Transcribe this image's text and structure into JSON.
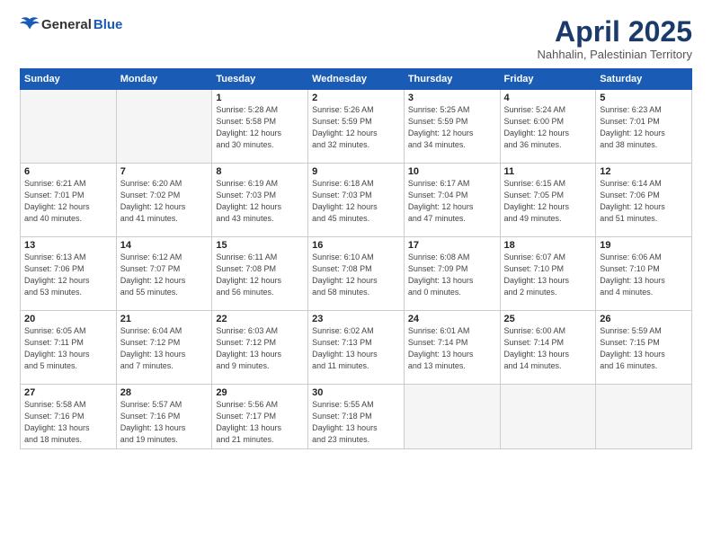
{
  "logo": {
    "general": "General",
    "blue": "Blue"
  },
  "header": {
    "month": "April 2025",
    "location": "Nahhalin, Palestinian Territory"
  },
  "weekdays": [
    "Sunday",
    "Monday",
    "Tuesday",
    "Wednesday",
    "Thursday",
    "Friday",
    "Saturday"
  ],
  "weeks": [
    [
      {
        "day": "",
        "info": ""
      },
      {
        "day": "",
        "info": ""
      },
      {
        "day": "1",
        "info": "Sunrise: 5:28 AM\nSunset: 5:58 PM\nDaylight: 12 hours\nand 30 minutes."
      },
      {
        "day": "2",
        "info": "Sunrise: 5:26 AM\nSunset: 5:59 PM\nDaylight: 12 hours\nand 32 minutes."
      },
      {
        "day": "3",
        "info": "Sunrise: 5:25 AM\nSunset: 5:59 PM\nDaylight: 12 hours\nand 34 minutes."
      },
      {
        "day": "4",
        "info": "Sunrise: 5:24 AM\nSunset: 6:00 PM\nDaylight: 12 hours\nand 36 minutes."
      },
      {
        "day": "5",
        "info": "Sunrise: 6:23 AM\nSunset: 7:01 PM\nDaylight: 12 hours\nand 38 minutes."
      }
    ],
    [
      {
        "day": "6",
        "info": "Sunrise: 6:21 AM\nSunset: 7:01 PM\nDaylight: 12 hours\nand 40 minutes."
      },
      {
        "day": "7",
        "info": "Sunrise: 6:20 AM\nSunset: 7:02 PM\nDaylight: 12 hours\nand 41 minutes."
      },
      {
        "day": "8",
        "info": "Sunrise: 6:19 AM\nSunset: 7:03 PM\nDaylight: 12 hours\nand 43 minutes."
      },
      {
        "day": "9",
        "info": "Sunrise: 6:18 AM\nSunset: 7:03 PM\nDaylight: 12 hours\nand 45 minutes."
      },
      {
        "day": "10",
        "info": "Sunrise: 6:17 AM\nSunset: 7:04 PM\nDaylight: 12 hours\nand 47 minutes."
      },
      {
        "day": "11",
        "info": "Sunrise: 6:15 AM\nSunset: 7:05 PM\nDaylight: 12 hours\nand 49 minutes."
      },
      {
        "day": "12",
        "info": "Sunrise: 6:14 AM\nSunset: 7:06 PM\nDaylight: 12 hours\nand 51 minutes."
      }
    ],
    [
      {
        "day": "13",
        "info": "Sunrise: 6:13 AM\nSunset: 7:06 PM\nDaylight: 12 hours\nand 53 minutes."
      },
      {
        "day": "14",
        "info": "Sunrise: 6:12 AM\nSunset: 7:07 PM\nDaylight: 12 hours\nand 55 minutes."
      },
      {
        "day": "15",
        "info": "Sunrise: 6:11 AM\nSunset: 7:08 PM\nDaylight: 12 hours\nand 56 minutes."
      },
      {
        "day": "16",
        "info": "Sunrise: 6:10 AM\nSunset: 7:08 PM\nDaylight: 12 hours\nand 58 minutes."
      },
      {
        "day": "17",
        "info": "Sunrise: 6:08 AM\nSunset: 7:09 PM\nDaylight: 13 hours\nand 0 minutes."
      },
      {
        "day": "18",
        "info": "Sunrise: 6:07 AM\nSunset: 7:10 PM\nDaylight: 13 hours\nand 2 minutes."
      },
      {
        "day": "19",
        "info": "Sunrise: 6:06 AM\nSunset: 7:10 PM\nDaylight: 13 hours\nand 4 minutes."
      }
    ],
    [
      {
        "day": "20",
        "info": "Sunrise: 6:05 AM\nSunset: 7:11 PM\nDaylight: 13 hours\nand 5 minutes."
      },
      {
        "day": "21",
        "info": "Sunrise: 6:04 AM\nSunset: 7:12 PM\nDaylight: 13 hours\nand 7 minutes."
      },
      {
        "day": "22",
        "info": "Sunrise: 6:03 AM\nSunset: 7:12 PM\nDaylight: 13 hours\nand 9 minutes."
      },
      {
        "day": "23",
        "info": "Sunrise: 6:02 AM\nSunset: 7:13 PM\nDaylight: 13 hours\nand 11 minutes."
      },
      {
        "day": "24",
        "info": "Sunrise: 6:01 AM\nSunset: 7:14 PM\nDaylight: 13 hours\nand 13 minutes."
      },
      {
        "day": "25",
        "info": "Sunrise: 6:00 AM\nSunset: 7:14 PM\nDaylight: 13 hours\nand 14 minutes."
      },
      {
        "day": "26",
        "info": "Sunrise: 5:59 AM\nSunset: 7:15 PM\nDaylight: 13 hours\nand 16 minutes."
      }
    ],
    [
      {
        "day": "27",
        "info": "Sunrise: 5:58 AM\nSunset: 7:16 PM\nDaylight: 13 hours\nand 18 minutes."
      },
      {
        "day": "28",
        "info": "Sunrise: 5:57 AM\nSunset: 7:16 PM\nDaylight: 13 hours\nand 19 minutes."
      },
      {
        "day": "29",
        "info": "Sunrise: 5:56 AM\nSunset: 7:17 PM\nDaylight: 13 hours\nand 21 minutes."
      },
      {
        "day": "30",
        "info": "Sunrise: 5:55 AM\nSunset: 7:18 PM\nDaylight: 13 hours\nand 23 minutes."
      },
      {
        "day": "",
        "info": ""
      },
      {
        "day": "",
        "info": ""
      },
      {
        "day": "",
        "info": ""
      }
    ]
  ]
}
